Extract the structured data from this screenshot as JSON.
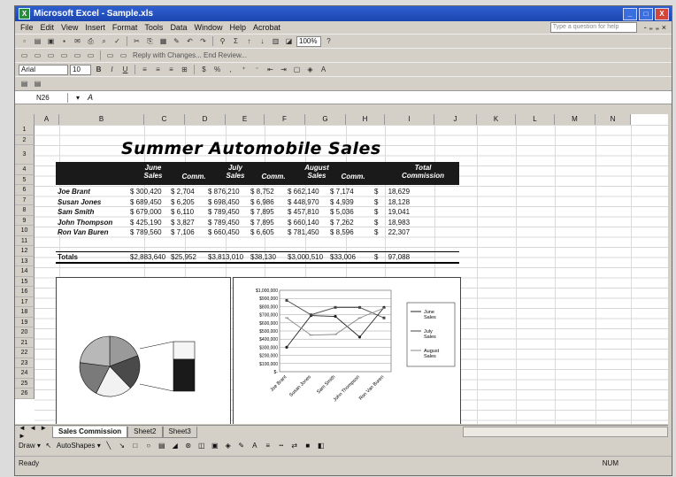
{
  "window": {
    "title": "Microsoft Excel - Sample.xls",
    "app_icon": "excel-icon",
    "min": "_",
    "max": "□",
    "close": "X"
  },
  "menu": {
    "items": [
      "File",
      "Edit",
      "View",
      "Insert",
      "Format",
      "Tools",
      "Data",
      "Window",
      "Help",
      "Acrobat"
    ],
    "ask": "Type a question for help",
    "tail": "- ₌ ₌ ×"
  },
  "toolbar": {
    "zoom": "100%",
    "font_name": "Arial",
    "font_size": "10",
    "review_text": "Reply with Changes...  End Review..."
  },
  "formula": {
    "name_box": "N26",
    "value": "A",
    "fx": "fx"
  },
  "columns": [
    "A",
    "B",
    "C",
    "D",
    "E",
    "F",
    "G",
    "H",
    "I",
    "J",
    "K",
    "L",
    "M",
    "N"
  ],
  "rows": [
    "1",
    "2",
    "3",
    "4",
    "5",
    "6",
    "7",
    "8",
    "9",
    "10",
    "11",
    "12",
    "13",
    "14",
    "15",
    "16",
    "17",
    "18",
    "19",
    "20",
    "21",
    "22",
    "23",
    "24",
    "25",
    "26"
  ],
  "sheet": {
    "title": "Summer Automobile Sales",
    "headers": {
      "june": "June\nSales",
      "june_comm": "Comm.",
      "july": "July\nSales",
      "july_comm": "Comm.",
      "aug": "August\nSales",
      "aug_comm": "Comm.",
      "total": "Total\nCommission"
    },
    "rows": [
      {
        "name": "Joe Brant",
        "june": "$ 300,420",
        "jc": "$ 2,704",
        "july": "$ 876,210",
        "jlc": "$ 8,752",
        "aug": "$ 662,140",
        "ac": "$ 7,174",
        "tot": "$     18,629"
      },
      {
        "name": "Susan Jones",
        "june": "$ 689,450",
        "jc": "$ 6,205",
        "july": "$ 698,450",
        "jlc": "$ 6,986",
        "aug": "$ 448,970",
        "ac": "$ 4,939",
        "tot": "$     18,128"
      },
      {
        "name": "Sam Smith",
        "june": "$ 679,000",
        "jc": "$ 6,110",
        "july": "$ 789,450",
        "jlc": "$ 7,895",
        "aug": "$ 457,810",
        "ac": "$ 5,036",
        "tot": "$     19,041"
      },
      {
        "name": "John Thompson",
        "june": "$ 425,190",
        "jc": "$ 3,827",
        "july": "$ 789,450",
        "jlc": "$ 7,895",
        "aug": "$ 660,140",
        "ac": "$ 7,262",
        "tot": "$     18,983"
      },
      {
        "name": "Ron Van Buren",
        "june": "$ 789,560",
        "jc": "$ 7,106",
        "july": "$ 660,450",
        "jlc": "$ 6,605",
        "aug": "$ 781,450",
        "ac": "$ 8,596",
        "tot": "$     22,307"
      }
    ],
    "totals": {
      "label": "Totals",
      "june": "$2,883,640",
      "jc": "$25,952",
      "july": "$3,813,010",
      "jlc": "$38,130",
      "aug": "$3,000,510",
      "ac": "$33,006",
      "tot": "$     97,088"
    }
  },
  "chart_data": [
    {
      "type": "pie",
      "title": "",
      "values": [
        18629,
        18128,
        19041,
        18983,
        22307
      ],
      "categories": [
        "Joe Brant",
        "Susan Jones",
        "Sam Smith",
        "John Thompson",
        "Ron Van Buren"
      ]
    },
    {
      "type": "line",
      "categories": [
        "Joe Brant",
        "Susan Jones",
        "Sam Smith",
        "John Thompson",
        "Ron Van Buren"
      ],
      "ylim": [
        0,
        1000000
      ],
      "yticks": [
        "$1,000,000",
        "$900,000",
        "$800,000",
        "$700,000",
        "$600,000",
        "$500,000",
        "$400,000",
        "$300,000",
        "$200,000",
        "$100,000",
        "$-"
      ],
      "series": [
        {
          "name": "June Sales",
          "values": [
            300420,
            689450,
            679000,
            425190,
            789560
          ]
        },
        {
          "name": "July Sales",
          "values": [
            876210,
            698450,
            789450,
            789450,
            660450
          ]
        },
        {
          "name": "August Sales",
          "values": [
            662140,
            448970,
            457810,
            660140,
            781450
          ]
        }
      ],
      "legend": "right"
    }
  ],
  "sheettabs": {
    "nav": "◄ ◄ ► ►",
    "tabs": [
      "Sales Commission",
      "Sheet2",
      "Sheet3"
    ]
  },
  "drawbar": {
    "draw": "Draw ▾",
    "autoshapes": "AutoShapes ▾"
  },
  "status": {
    "left": "Ready",
    "num": "NUM"
  }
}
